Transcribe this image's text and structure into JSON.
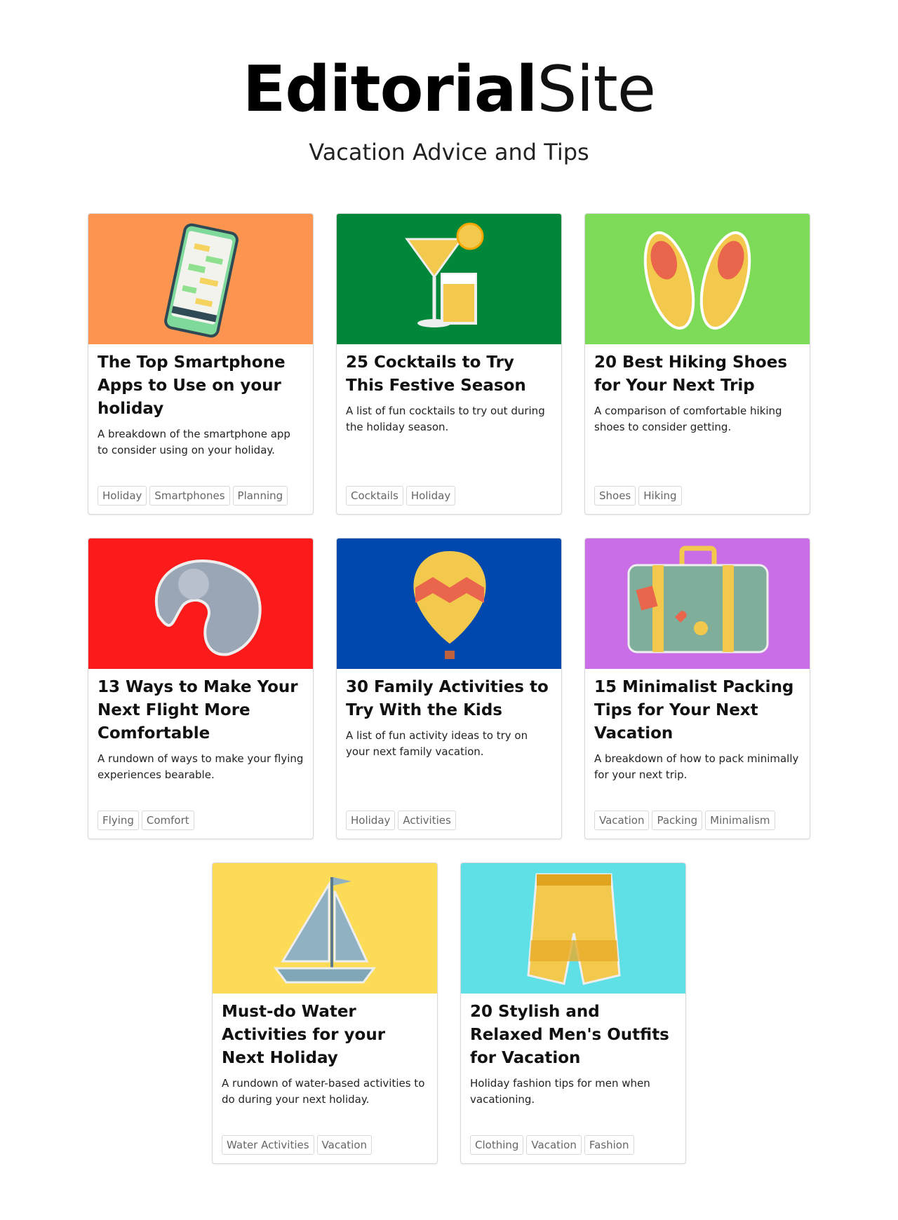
{
  "site": {
    "logo_bold": "Editorial",
    "logo_light": "Site",
    "tagline": "Vacation Advice and Tips"
  },
  "cards": [
    {
      "title": "The Top Smartphone Apps to Use on your holiday",
      "description": "A breakdown of the smartphone app to consider using on your holiday.",
      "tags": [
        "Holiday",
        "Smartphones",
        "Planning"
      ],
      "color": "#fd944f",
      "icon": "smartphone-icon"
    },
    {
      "title": "25 Cocktails to Try This Festive Season",
      "description": "A list of fun cocktails to try out during the holiday season.",
      "tags": [
        "Cocktails",
        "Holiday"
      ],
      "color": "#00873a",
      "icon": "cocktail-icon"
    },
    {
      "title": "20 Best Hiking Shoes for Your Next Trip",
      "description": "A comparison of comfortable hiking shoes to consider getting.",
      "tags": [
        "Shoes",
        "Hiking"
      ],
      "color": "#7edb57",
      "icon": "sneakers-icon"
    },
    {
      "title": "13 Ways to Make Your Next Flight More Comfortable",
      "description": "A rundown of ways to make your flying experiences bearable.",
      "tags": [
        "Flying",
        "Comfort"
      ],
      "color": "#fd1a1b",
      "icon": "neck-pillow-icon"
    },
    {
      "title": "30 Family Activities to Try With the Kids",
      "description": "A list of fun activity ideas to try on your next family vacation.",
      "tags": [
        "Holiday",
        "Activities"
      ],
      "color": "#0047ae",
      "icon": "hot-air-balloon-icon"
    },
    {
      "title": "15 Minimalist Packing Tips for Your Next Vacation",
      "description": "A breakdown of how to pack minimally for your next trip.",
      "tags": [
        "Vacation",
        "Packing",
        "Minimalism"
      ],
      "color": "#c96ee6",
      "icon": "suitcase-icon"
    },
    {
      "title": "Must-do Water Activities for your Next Holiday",
      "description": "A rundown of water-based activities to do during your next holiday.",
      "tags": [
        "Water Activities",
        "Vacation"
      ],
      "color": "#fcdc57",
      "icon": "sailboat-icon"
    },
    {
      "title": "20 Stylish and Relaxed Men's Outfits for Vacation",
      "description": "Holiday fashion tips for men when vacationing.",
      "tags": [
        "Clothing",
        "Vacation",
        "Fashion"
      ],
      "color": "#5ee0e6",
      "icon": "shorts-icon"
    }
  ]
}
